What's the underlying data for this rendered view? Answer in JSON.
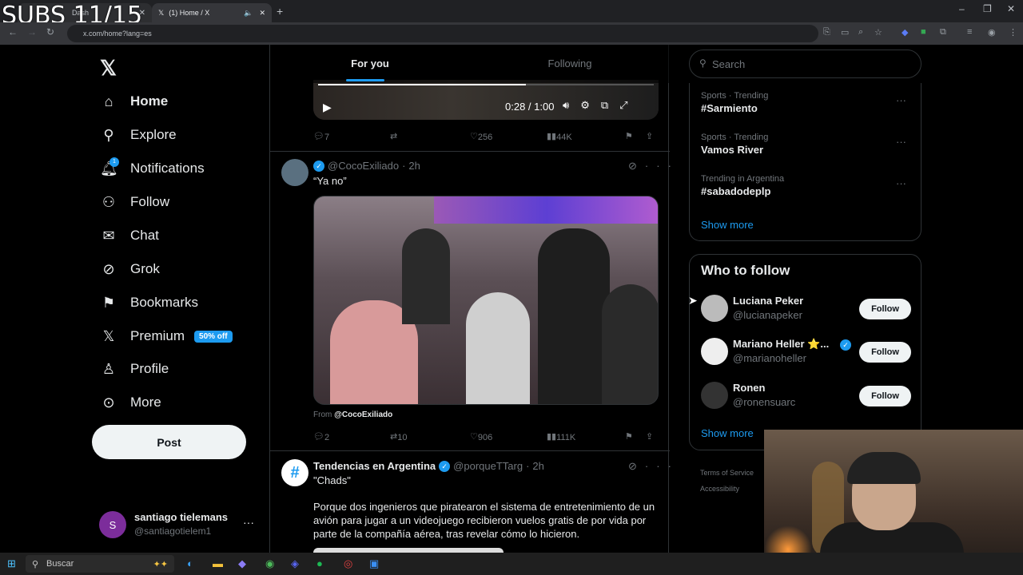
{
  "overlay": {
    "subs": "SUBS 11/15"
  },
  "browser": {
    "tab1_title": "Dash",
    "tab2_title": "(1) Home / X",
    "url": "x.com/home?lang=es"
  },
  "nav": {
    "items": [
      {
        "label": "Home",
        "icon": "home-icon"
      },
      {
        "label": "Explore",
        "icon": "search-icon"
      },
      {
        "label": "Notifications",
        "icon": "bell-icon",
        "badge": "1"
      },
      {
        "label": "Follow",
        "icon": "person-add-icon"
      },
      {
        "label": "Chat",
        "icon": "mail-icon"
      },
      {
        "label": "Grok",
        "icon": "grok-icon"
      },
      {
        "label": "Bookmarks",
        "icon": "bookmark-icon"
      },
      {
        "label": "Premium",
        "icon": "x-logo-icon",
        "badge": "50% off"
      },
      {
        "label": "Profile",
        "icon": "person-icon"
      },
      {
        "label": "More",
        "icon": "more-circle-icon"
      }
    ],
    "post_label": "Post",
    "account": {
      "initial": "S",
      "name": "santiago tielemans",
      "handle": "@santiagotielem1"
    }
  },
  "feed": {
    "tabs": [
      "For you",
      "Following"
    ],
    "video": {
      "time": "0:28 / 1:00",
      "progress": 0.62
    },
    "first_actions": {
      "replies": "7",
      "reposts": "",
      "likes": "256",
      "views": "44K"
    },
    "tweet2": {
      "handle": "@CocoExiliado",
      "time": "2h",
      "text": "“Ya no”",
      "from_label": "From",
      "from_handle": "@CocoExiliado",
      "replies": "2",
      "reposts": "10",
      "likes": "906",
      "views": "111K"
    },
    "tweet3": {
      "name": "Tendencias en Argentina",
      "handle": "@porqueTTarg",
      "time": "2h",
      "quote": "\"Chads\"",
      "text": "Porque dos ingenieros que piratearon el sistema de entretenimiento de un avión para jugar a un videojuego recibieron vuelos gratis de por vida por parte de la compañía aérea, tras revelar cómo lo hicieron."
    }
  },
  "right": {
    "search_placeholder": "Search",
    "trends": [
      {
        "category": "Sports · Trending",
        "name": "#Sarmiento"
      },
      {
        "category": "Sports · Trending",
        "name": "Vamos River"
      },
      {
        "category": "Trending in Argentina",
        "name": "#sabadodeplp"
      }
    ],
    "show_more": "Show more",
    "who_to_follow": {
      "title": "Who to follow",
      "follow_label": "Follow",
      "people": [
        {
          "name": "Luciana Peker",
          "handle": "@lucianapeker"
        },
        {
          "name": "Mariano Heller ⭐...",
          "handle": "@marianoheller"
        },
        {
          "name": "Ronen",
          "handle": "@ronensuarc"
        }
      ],
      "show_more": "Show more"
    },
    "footer": [
      "Terms of Service",
      "Accessibility"
    ]
  },
  "taskbar": {
    "search": "Buscar"
  }
}
